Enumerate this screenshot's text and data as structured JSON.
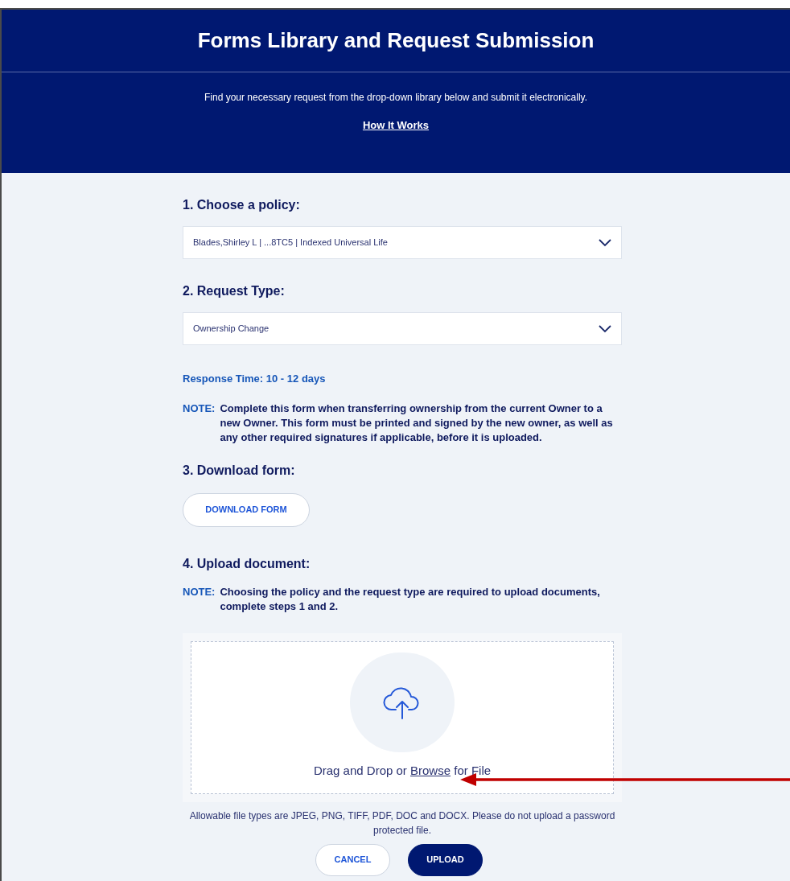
{
  "header": {
    "title": "Forms Library and Request Submission",
    "subtitle": "Find your necessary request from the drop-down library below and submit it electronically.",
    "link": "How It Works"
  },
  "policy": {
    "label": "1. Choose a policy:",
    "value": "Blades,Shirley L | ...8TC5 | Indexed Universal Life"
  },
  "request_type": {
    "label": "2. Request Type:",
    "value": "Ownership Change"
  },
  "response_time": "Response Time: 10 - 12 days",
  "note_1": {
    "tag": "NOTE:",
    "text": "Complete this form when transferring ownership from the current Owner to a new Owner. This form must be printed and signed by the new owner, as well as any other required signatures if applicable, before it is uploaded."
  },
  "download": {
    "label": "3. Download form:",
    "button": "DOWNLOAD FORM"
  },
  "upload": {
    "label": "4. Upload document:",
    "note_tag": "NOTE:",
    "note": "Choosing the policy and the request type are required to upload documents, complete steps 1 and 2.",
    "drop_text": "Drag and Drop or",
    "browse": "Browse",
    "drop_tail": "for File",
    "hint": "Allowable file types are JPEG, PNG, TIFF, PDF, DOC and DOCX. Please do not upload a password protected file."
  },
  "buttons": [
    {
      "label": "CANCEL",
      "kind": "secondary"
    },
    {
      "label": "UPLOAD",
      "kind": "primary"
    }
  ]
}
